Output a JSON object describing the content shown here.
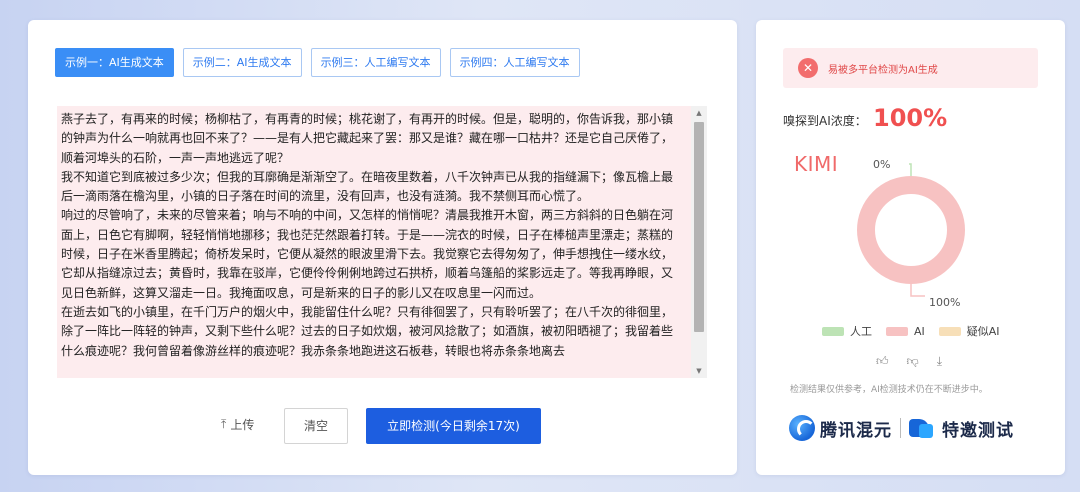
{
  "tabs": [
    {
      "label": "示例一：AI生成文本",
      "active": true
    },
    {
      "label": "示例二：AI生成文本",
      "active": false
    },
    {
      "label": "示例三：人工编写文本",
      "active": false
    },
    {
      "label": "示例四：人工编写文本",
      "active": false
    }
  ],
  "input_text": "燕子去了，有再来的时候；杨柳枯了，有再青的时候；桃花谢了，有再开的时候。但是，聪明的，你告诉我，那小镇的钟声为什么一响就再也回不来了？——是有人把它藏起来了罢：那又是谁？藏在哪一口枯井？还是它自己厌倦了，顺着河埠头的石阶，一声一声地逃远了呢？\n我不知道它到底被过多少次；但我的耳廓确是渐渐空了。在暗夜里数着，八千次钟声已从我的指缝漏下；像瓦檐上最后一滴雨落在檐沟里，小镇的日子落在时间的流里，没有回声，也没有涟漪。我不禁侧耳而心慌了。\n响过的尽管响了，未来的尽管来着；响与不响的中间，又怎样的悄悄呢？清晨我推开木窗，两三方斜斜的日色躺在河面上，日色它有脚啊，轻轻悄悄地挪移；我也茫茫然跟着打转。于是——浣衣的时候，日子在棒槌声里漂走；蒸糕的时候，日子在米香里腾起；倚桥发呆时，它便从凝然的眼波里滑下去。我觉察它去得匆匆了，伸手想拽住一缕水纹，它却从指缝凉过去；黄昏时，我靠在驳岸，它便伶伶俐俐地跨过石拱桥，顺着乌篷船的桨影远走了。等我再睁眼，又见日色新鲜，这算又溜走一日。我掩面叹息，可是新来的日子的影儿又在叹息里一闪而过。\n在逝去如飞的小镇里，在千门万户的烟火中，我能留住什么呢？只有徘徊罢了，只有聆听罢了；在八千次的徘徊里，除了一阵比一阵轻的钟声，又剩下些什么呢？过去的日子如炊烟，被河风捻散了；如酒旗，被初阳晒褪了；我留着些什么痕迹呢？我何曾留着像游丝样的痕迹呢？我赤条条地跑进这石板巷，转眼也将赤条条地离去",
  "upload_label": "上传",
  "clear_label": "清空",
  "detect_label": "立即检测(今日剩余17次)",
  "alert_text": "易被多平台检测为AI生成",
  "concentration_label": "嗅探到AI浓度：",
  "concentration_value": "100%",
  "model_label": "KIMI",
  "chart_data": {
    "type": "pie",
    "categories": [
      "人工",
      "AI",
      "疑似AI"
    ],
    "values": [
      0,
      100,
      0
    ],
    "labels_shown": [
      "0%",
      "100%"
    ]
  },
  "colors": {
    "human": "#bde3b5",
    "ai": "#f7c2c2",
    "suspect": "#f7dfb8"
  },
  "legend": [
    "人工",
    "AI",
    "疑似AI"
  ],
  "disclaimer": "检测结果仅供参考，AI检测技术仍在不断进步中。",
  "brand_text": "腾讯混元",
  "partner_text": "特邀测试"
}
